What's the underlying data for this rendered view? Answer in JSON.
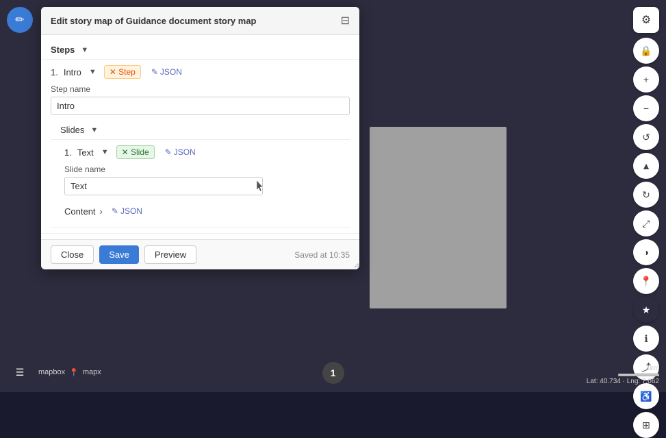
{
  "map": {
    "background": "#2c2c3e"
  },
  "topLeftButton": {
    "icon": "✏️",
    "ariaLabel": "edit-mode"
  },
  "topRightButton": {
    "icon": "⚙",
    "ariaLabel": "settings"
  },
  "rightControls": [
    {
      "id": "lock",
      "icon": "🔒",
      "active": false
    },
    {
      "id": "plus",
      "icon": "+",
      "active": false
    },
    {
      "id": "minus",
      "icon": "−",
      "active": false
    },
    {
      "id": "refresh",
      "icon": "↺",
      "active": false
    },
    {
      "id": "compass",
      "icon": "▲",
      "active": false
    },
    {
      "id": "cycle",
      "icon": "↻",
      "active": false
    },
    {
      "id": "expand",
      "icon": "⤢",
      "active": false
    },
    {
      "id": "contrast",
      "icon": "◑",
      "active": false
    },
    {
      "id": "location",
      "icon": "📍",
      "active": false
    },
    {
      "id": "star-active",
      "icon": "★",
      "active": true
    },
    {
      "id": "info",
      "icon": "ℹ",
      "active": false
    },
    {
      "id": "share",
      "icon": "⤴",
      "active": false
    },
    {
      "id": "accessibility",
      "icon": "♿",
      "active": false
    },
    {
      "id": "layers",
      "icon": "⊞",
      "active": false
    }
  ],
  "bottomLeft": {
    "listIcon": "☰",
    "mapboxLabel": "mapbox",
    "mapxLabel": "mapx",
    "mapxHasPin": true
  },
  "bottomCenter": {
    "number": "1"
  },
  "bottomRight": {
    "scale": "1km",
    "coords": "Lat: 40.734 · Lng: 7.062"
  },
  "dialog": {
    "title": "Edit story map of Guidance document story map",
    "closeIcon": "⊟",
    "stepsHeader": "Steps",
    "stepsChevron": "▼",
    "step": {
      "number": "1.",
      "name": "Intro",
      "chevron": "▼",
      "tagStep": "✕ Step",
      "tagJson": "✎ JSON",
      "fieldLabel": "Step name",
      "fieldValue": "Intro",
      "fieldPlaceholder": "Step name"
    },
    "slidesHeader": "Slides",
    "slidesChevron": "▼",
    "slide": {
      "number": "1.",
      "name": "Text",
      "chevron": "▼",
      "tagSlide": "✕ Slide",
      "tagJson": "✎ JSON",
      "fieldLabel": "Slide name",
      "fieldValue": "Text",
      "fieldPlaceholder": "Slide name"
    },
    "content": {
      "label": "Content",
      "chevron": "›",
      "tagJson": "✎ JSON"
    },
    "footer": {
      "closeLabel": "Close",
      "saveLabel": "Save",
      "previewLabel": "Preview",
      "savedText": "Saved at 10:35"
    }
  }
}
